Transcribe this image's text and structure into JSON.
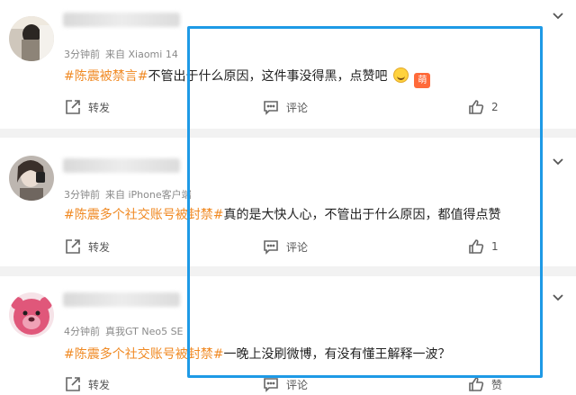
{
  "comments": [
    {
      "time": "3分钟前",
      "source": "来自 Xiaomi 14",
      "hashtag": "#陈震被禁言#",
      "body": "不管出于什么原因，这件事没得黑，点赞吧",
      "emoji_badge": "萌",
      "forward_label": "转发",
      "comment_label": "评论",
      "like_count": "2"
    },
    {
      "time": "3分钟前",
      "source": "来自 iPhone客户端",
      "hashtag": "#陈震多个社交账号被封禁#",
      "body": "真的是大快人心，不管出于什么原因，都值得点赞",
      "forward_label": "转发",
      "comment_label": "评论",
      "like_count": "1"
    },
    {
      "time": "4分钟前",
      "source": "真我GT Neo5 SE",
      "hashtag": "#陈震多个社交账号被封禁#",
      "body": "一晚上没刷微博，有没有懂王解释一波？",
      "forward_label": "转发",
      "comment_label": "评论",
      "like_label": "赞"
    }
  ],
  "colors": {
    "hashtag": "#f08a24",
    "highlight_border": "#1e9ae6"
  },
  "icons": [
    "avatar",
    "chevron-down-icon",
    "forward-icon",
    "comment-icon",
    "thumbs-up-icon",
    "grin-emoji-icon"
  ]
}
